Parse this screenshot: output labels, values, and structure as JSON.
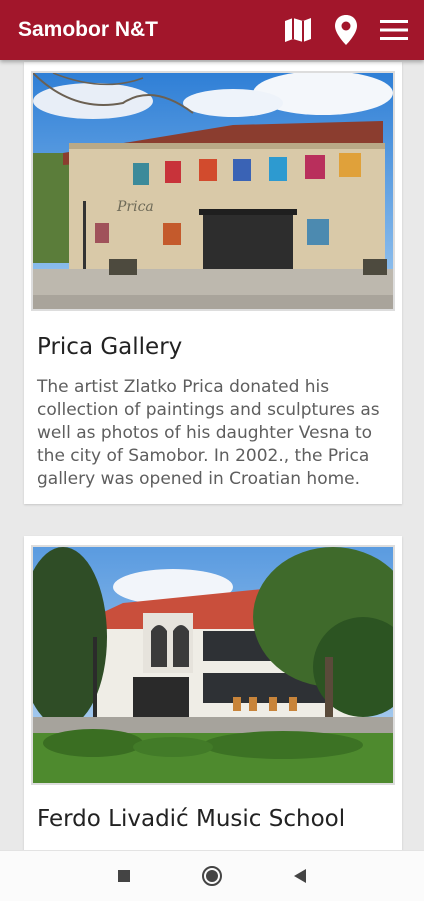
{
  "app": {
    "title": "Samobor N&T"
  },
  "toolbar": {
    "icons": [
      "map-icon",
      "location-pin-icon",
      "menu-icon"
    ]
  },
  "items": [
    {
      "title": "Prica Gallery",
      "description": "The artist Zlatko Prica donated his collection of paintings and sculptures as well as photos of his daughter Vesna to the city of Samobor. In 2002., the Prica gallery was opened in Croatian home."
    },
    {
      "title": "Ferdo Livadić Music School",
      "description": ""
    }
  ],
  "system_nav": {
    "icons": [
      "recents-square-icon",
      "home-circle-icon",
      "back-triangle-icon"
    ]
  },
  "colors": {
    "appbar": "#a2162b",
    "background": "#e9e9e9"
  }
}
